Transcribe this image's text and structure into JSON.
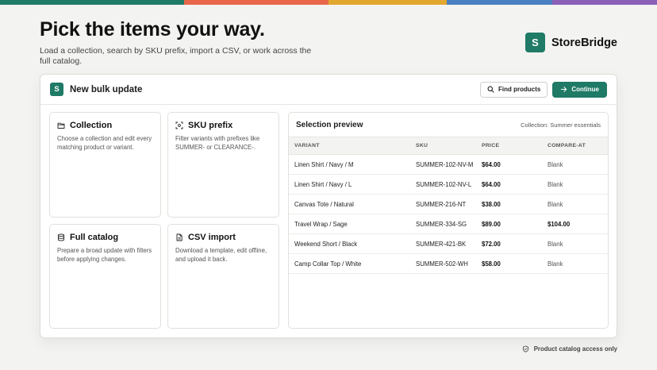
{
  "stripe_colors": [
    "#1f7a66",
    "#e8674a",
    "#e2a72e",
    "#4a7fc1",
    "#8a5fb8"
  ],
  "hero": {
    "title": "Pick the items your way.",
    "subtitle": "Load a collection, search by SKU prefix, import a CSV, or work across the full catalog."
  },
  "brand": {
    "logo_letter": "S",
    "name": "StoreBridge"
  },
  "panel": {
    "logo_letter": "S",
    "title": "New bulk update",
    "find_label": "Find products",
    "continue_label": "Continue"
  },
  "cards": [
    {
      "icon": "folder-icon",
      "title": "Collection",
      "desc": "Choose a collection and edit every matching product or variant."
    },
    {
      "icon": "scan-icon",
      "title": "SKU prefix",
      "desc": "Filter variants with prefixes like SUMMER- or CLEARANCE-."
    },
    {
      "icon": "database-icon",
      "title": "Full catalog",
      "desc": "Prepare a broad update with filters before applying changes."
    },
    {
      "icon": "file-icon",
      "title": "CSV import",
      "desc": "Download a template, edit offline, and upload it back."
    }
  ],
  "preview": {
    "title": "Selection preview",
    "meta": "Collection: Summer essentials",
    "columns": [
      "VARIANT",
      "SKU",
      "PRICE",
      "COMPARE-AT"
    ],
    "rows": [
      [
        "Linen Shirt / Navy / M",
        "SUMMER-102-NV-M",
        "$64.00",
        "Blank"
      ],
      [
        "Linen Shirt / Navy / L",
        "SUMMER-102-NV-L",
        "$64.00",
        "Blank"
      ],
      [
        "Canvas Tote / Natural",
        "SUMMER-216-NT",
        "$38.00",
        "Blank"
      ],
      [
        "Travel Wrap / Sage",
        "SUMMER-334-SG",
        "$89.00",
        "$104.00"
      ],
      [
        "Weekend Short / Black",
        "SUMMER-421-BK",
        "$72.00",
        "Blank"
      ],
      [
        "Camp Collar Top / White",
        "SUMMER-502-WH",
        "$58.00",
        "Blank"
      ]
    ]
  },
  "footer": {
    "note": "Product catalog access only"
  }
}
